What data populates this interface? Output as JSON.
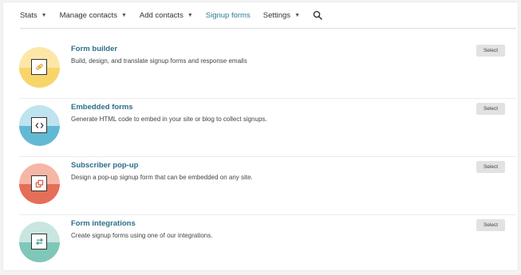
{
  "nav": {
    "items": [
      {
        "label": "Stats",
        "dropdown": true
      },
      {
        "label": "Manage contacts",
        "dropdown": true
      },
      {
        "label": "Add contacts",
        "dropdown": true
      },
      {
        "label": "Signup forms",
        "dropdown": false,
        "active": true
      },
      {
        "label": "Settings",
        "dropdown": true
      }
    ],
    "search_icon": "search-icon"
  },
  "forms": [
    {
      "title": "Form builder",
      "description": "Build, design, and translate signup forms and response emails",
      "button": "Select",
      "icon": "link-icon",
      "colors": {
        "top": "#fde7a8",
        "bottom": "#f8d56b",
        "glyph": "#e2a92a"
      }
    },
    {
      "title": "Embedded forms",
      "description": "Generate HTML code to embed in your site or blog to collect signups.",
      "button": "Select",
      "icon": "code-icon",
      "colors": {
        "top": "#bfe3ef",
        "bottom": "#62b9d4",
        "glyph": "#333333"
      }
    },
    {
      "title": "Subscriber pop-up",
      "description": "Design a pop-up signup form that can be embedded on any site.",
      "button": "Select",
      "icon": "popup-icon",
      "colors": {
        "top": "#f6b6a6",
        "bottom": "#e56e58",
        "glyph": "#d9563f"
      }
    },
    {
      "title": "Form integrations",
      "description": "Create signup forms using one of our integrations.",
      "button": "Select",
      "icon": "swap-arrows-icon",
      "colors": {
        "top": "#c8e6df",
        "bottom": "#7fc7b8",
        "glyph": "#3d9a88"
      }
    }
  ]
}
